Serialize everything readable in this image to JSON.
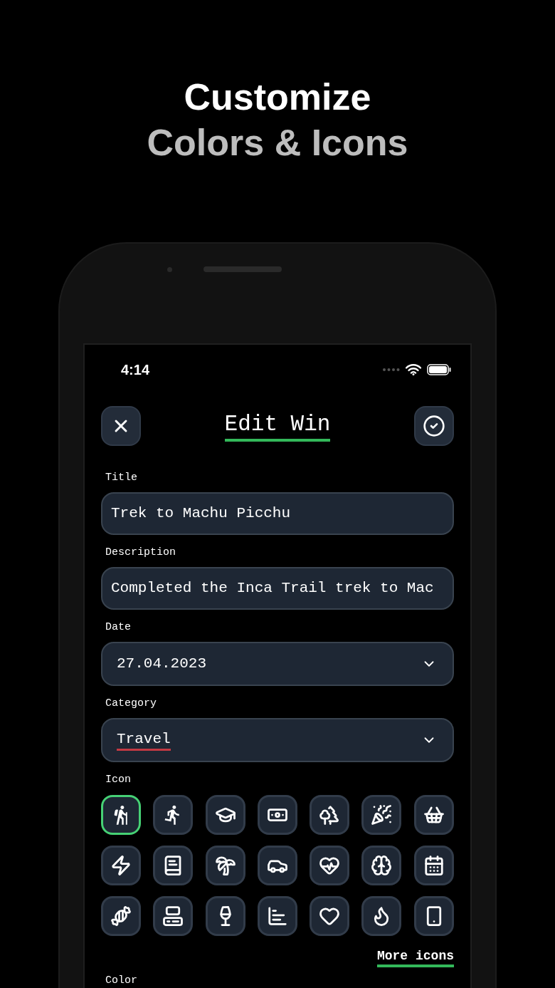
{
  "headline": {
    "line_1": "Customize",
    "line_2": "Colors & Icons"
  },
  "status_bar": {
    "time": "4:14"
  },
  "header": {
    "title": "Edit Win"
  },
  "fields": [
    {
      "kind": "text",
      "label": "Title",
      "value": "Trek to Machu Picchu",
      "misspelled": false
    },
    {
      "kind": "text",
      "label": "Description",
      "value": "Completed the Inca Trail trek to Mac",
      "misspelled": false
    },
    {
      "kind": "dropdown",
      "label": "Date",
      "value": "27.04.2023",
      "misspelled": false
    },
    {
      "kind": "dropdown",
      "label": "Category",
      "value": "Travel",
      "misspelled": true
    }
  ],
  "icon_picker": {
    "label": "Icon",
    "more_link": "More icons",
    "icons": [
      {
        "kind": "hiker",
        "selected": true
      },
      {
        "kind": "runner",
        "selected": false
      },
      {
        "kind": "graduation-cap",
        "selected": false
      },
      {
        "kind": "banknote",
        "selected": false
      },
      {
        "kind": "trees",
        "selected": false
      },
      {
        "kind": "party-popper",
        "selected": false
      },
      {
        "kind": "basket",
        "selected": false
      },
      {
        "kind": "lightning",
        "selected": false
      },
      {
        "kind": "book",
        "selected": false
      },
      {
        "kind": "palm-tree",
        "selected": false
      },
      {
        "kind": "car",
        "selected": false
      },
      {
        "kind": "heart-pulse",
        "selected": false
      },
      {
        "kind": "brain",
        "selected": false
      },
      {
        "kind": "calendar",
        "selected": false
      },
      {
        "kind": "candy",
        "selected": false
      },
      {
        "kind": "computer",
        "selected": false
      },
      {
        "kind": "wine-glass",
        "selected": false
      },
      {
        "kind": "bar-chart",
        "selected": false
      },
      {
        "kind": "heart",
        "selected": false
      },
      {
        "kind": "flame",
        "selected": false
      },
      {
        "kind": "smartphone",
        "selected": false
      }
    ]
  },
  "color_section": {
    "label": "Color"
  }
}
